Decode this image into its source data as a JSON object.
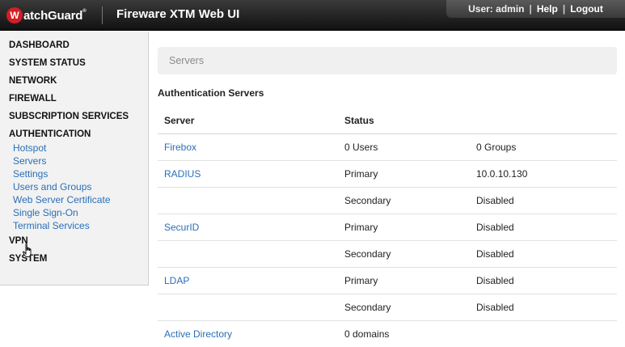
{
  "header": {
    "logo_mark": "W",
    "logo_text": "atchGuard",
    "logo_reg": "®",
    "product_title": "Fireware XTM Web UI",
    "user_label": "User: admin",
    "help_label": "Help",
    "logout_label": "Logout",
    "separator": "|"
  },
  "sidebar": {
    "sections": [
      {
        "label": "DASHBOARD"
      },
      {
        "label": "SYSTEM STATUS"
      },
      {
        "label": "NETWORK"
      },
      {
        "label": "FIREWALL"
      },
      {
        "label": "SUBSCRIPTION SERVICES"
      },
      {
        "label": "AUTHENTICATION"
      },
      {
        "label": "VPN"
      },
      {
        "label": "SYSTEM"
      }
    ],
    "auth_items": [
      {
        "label": "Hotspot"
      },
      {
        "label": "Servers"
      },
      {
        "label": "Settings"
      },
      {
        "label": "Users and Groups"
      },
      {
        "label": "Web Server Certificate"
      },
      {
        "label": "Single Sign-On"
      },
      {
        "label": "Terminal Services"
      }
    ]
  },
  "main": {
    "breadcrumb": "Servers",
    "section_title": "Authentication Servers",
    "table": {
      "headers": [
        "Server",
        "Status",
        ""
      ],
      "rows": [
        {
          "server": "Firebox",
          "status": "0 Users",
          "detail": "0 Groups"
        },
        {
          "server": "RADIUS",
          "status": "Primary",
          "detail": "10.0.10.130"
        },
        {
          "server": "",
          "status": "Secondary",
          "detail": "Disabled"
        },
        {
          "server": "SecurID",
          "status": "Primary",
          "detail": "Disabled"
        },
        {
          "server": "",
          "status": "Secondary",
          "detail": "Disabled"
        },
        {
          "server": "LDAP",
          "status": "Primary",
          "detail": "Disabled"
        },
        {
          "server": "",
          "status": "Secondary",
          "detail": "Disabled"
        },
        {
          "server": "Active Directory",
          "status": "0 domains",
          "detail": ""
        }
      ]
    }
  },
  "colors": {
    "header_bg": "#1c1c1c",
    "link": "#2a6fb8",
    "logo_red": "#d21f26",
    "sidebar_bg": "#f2f2f2"
  },
  "icons": {
    "pointer": "hand-pointer-icon"
  }
}
